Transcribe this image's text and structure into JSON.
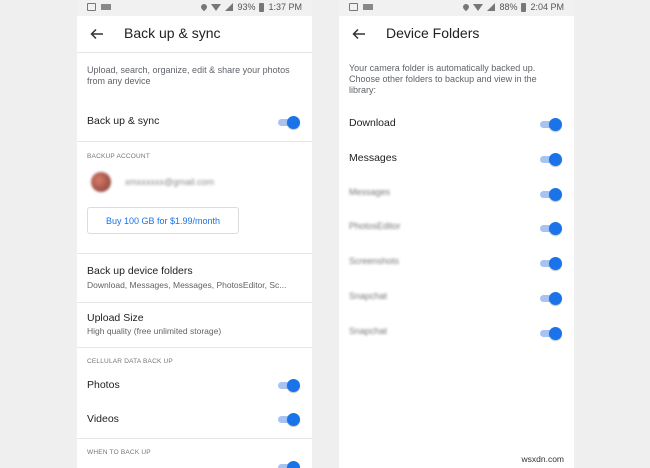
{
  "left": {
    "status": {
      "battery": "93%",
      "time": "1:37 PM"
    },
    "title": "Back up & sync",
    "description": "Upload, search, organize, edit & share your photos from any device",
    "backup_sync_label": "Back up & sync",
    "backup_account_header": "BACKUP ACCOUNT",
    "account_email": "xmxxxxxx@gmail.com",
    "buy_button_label": "Buy 100 GB for $1.99/month",
    "device_folders_title": "Back up device folders",
    "device_folders_sub": "Download, Messages, Messages, PhotosEditor, Sc...",
    "upload_size_title": "Upload Size",
    "upload_size_sub": "High quality (free unlimited storage)",
    "cellular_header": "CELLULAR DATA BACK UP",
    "photos_label": "Photos",
    "videos_label": "Videos",
    "when_header": "WHEN TO BACK UP"
  },
  "right": {
    "status": {
      "battery": "88%",
      "time": "2:04 PM"
    },
    "title": "Device Folders",
    "description": "Your camera folder is automatically backed up. Choose other folders to backup and view in the library:",
    "folders": [
      {
        "label": "Download",
        "blurred": false
      },
      {
        "label": "Messages",
        "blurred": false
      },
      {
        "label": "Messages",
        "blurred": true
      },
      {
        "label": "PhotosEditor",
        "blurred": true
      },
      {
        "label": "Screenshots",
        "blurred": true
      },
      {
        "label": "Snapchat",
        "blurred": true
      },
      {
        "label": "Snapchat",
        "blurred": true
      }
    ]
  },
  "watermark": "wsxdn.com",
  "colors": {
    "accent": "#1a73e8",
    "track": "#a6c3f2",
    "background": "#efefef"
  }
}
